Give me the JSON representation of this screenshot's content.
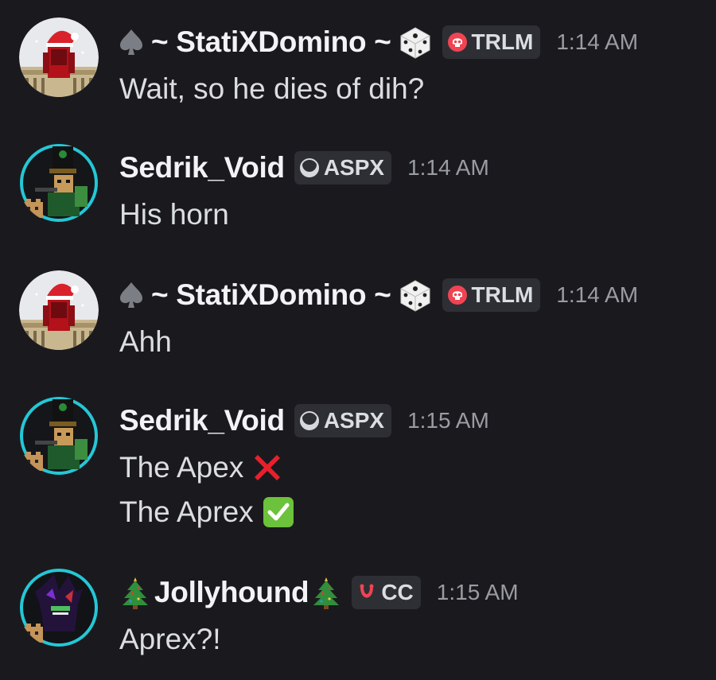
{
  "messages": [
    {
      "author": "~ StatiXDomino ~",
      "role_tag": "TRLM",
      "time": "1:14 AM",
      "lines": [
        "Wait, so he dies of dih?"
      ]
    },
    {
      "author": "Sedrik_Void",
      "role_tag": "ASPX",
      "time": "1:14 AM",
      "lines": [
        "His horn"
      ]
    },
    {
      "author": "~ StatiXDomino ~",
      "role_tag": "TRLM",
      "time": "1:14 AM",
      "lines": [
        "Ahh"
      ]
    },
    {
      "author": "Sedrik_Void",
      "role_tag": "ASPX",
      "time": "1:15 AM",
      "lines": [
        "The Apex",
        "The Aprex"
      ]
    },
    {
      "author": "Jollyhound",
      "role_tag": "CC",
      "time": "1:15 AM",
      "lines": [
        "Aprex?!"
      ]
    }
  ],
  "icons": {
    "prefix_decoration": "spade-icon",
    "suffix_decoration": "dice-icon",
    "trlm_tag_icon": "skull-icon",
    "aspx_tag_icon": "moon-icon",
    "cc_tag_icon": "horseshoe-icon",
    "jolly_decoration": "christmas-tree-icon",
    "apex_emoji": "cross-mark-icon",
    "aprex_emoji": "check-mark-icon"
  },
  "colors": {
    "background": "#1a1a1e",
    "username": "#f2f3f5",
    "message_text": "#dbdee1",
    "timestamp": "#9a9ca3",
    "tag_background": "#2e2f35"
  }
}
